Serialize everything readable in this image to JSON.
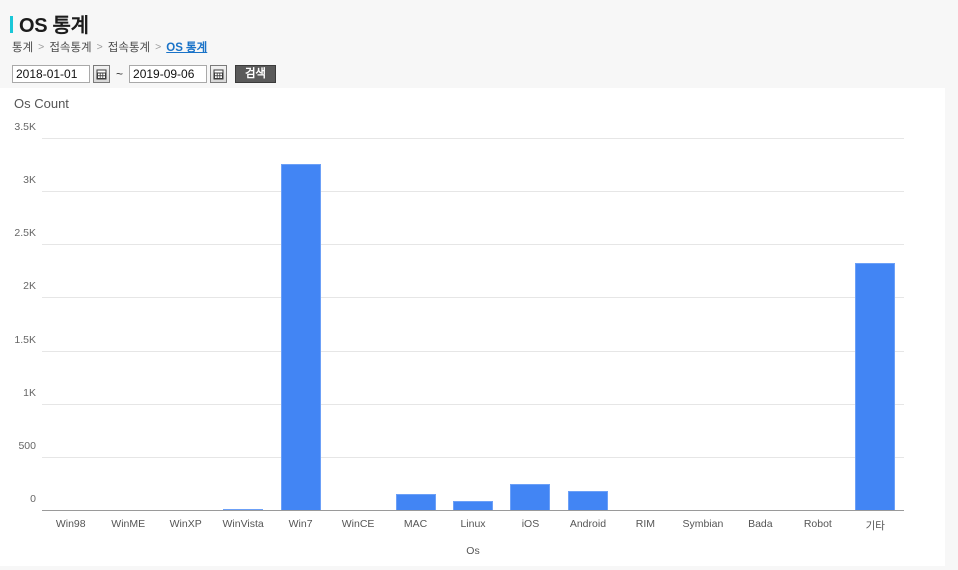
{
  "header": {
    "title": "OS 통계",
    "accent_color": "#19c7d8"
  },
  "breadcrumb": {
    "items": [
      "통계",
      "접속통계",
      "접속통계",
      "OS 통계"
    ],
    "separator": ">",
    "active_index": 3,
    "link_color": "#1a73c8"
  },
  "filters": {
    "start_date": "2018-01-01",
    "end_date": "2019-09-06",
    "start_placeholder": "YYYY-MM-DD",
    "end_placeholder": "YYYY-MM-DD",
    "range_separator": "~",
    "calendar_icon": "calendar-icon",
    "search_label": "검색"
  },
  "chart_data": {
    "type": "bar",
    "title": "Os Count",
    "xlabel": "Os",
    "ylabel": "",
    "categories": [
      "Win98",
      "WinME",
      "WinXP",
      "WinVista",
      "Win7",
      "WinCE",
      "MAC",
      "Linux",
      "iOS",
      "Android",
      "RIM",
      "Symbian",
      "Bada",
      "Robot",
      "기타"
    ],
    "values": [
      0,
      0,
      0,
      5,
      3265,
      0,
      160,
      95,
      255,
      190,
      0,
      0,
      0,
      0,
      2335
    ],
    "ytick_labels": [
      "0",
      "500",
      "1K",
      "1.5K",
      "2K",
      "2.5K",
      "3K",
      "3.5K"
    ],
    "ytick_values": [
      0,
      500,
      1000,
      1500,
      2000,
      2500,
      3000,
      3500
    ],
    "ylim": [
      0,
      3500
    ],
    "grid": true,
    "legend": false,
    "bar_color": "#4285f4"
  }
}
